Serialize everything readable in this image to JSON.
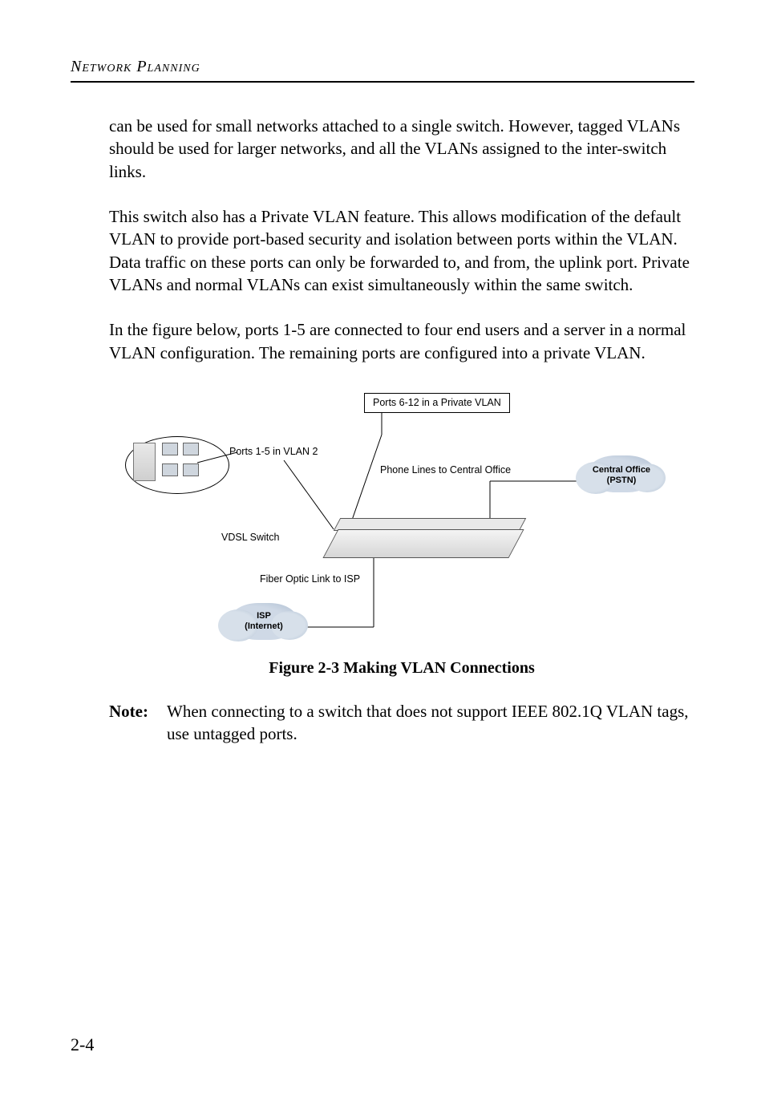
{
  "header": {
    "running_head": "Network Planning"
  },
  "paragraphs": {
    "p1": "can be used for small networks attached to a single switch. However, tagged VLANs should be used for larger networks, and all the VLANs assigned to the inter-switch links.",
    "p2": "This switch also has a Private VLAN feature. This allows modification of the default VLAN to provide port-based security and isolation between ports within the VLAN. Data traffic on these ports can only be forwarded to, and from, the uplink port. Private VLANs and normal VLANs can exist simultaneously within the same switch.",
    "p3": "In the figure below, ports 1-5 are connected to four end users and a server in a normal VLAN configuration. The remaining ports are configured into a private VLAN."
  },
  "figure": {
    "caption": "Figure 2-3  Making VLAN Connections",
    "labels": {
      "private_vlan": "Ports 6-12 in a Private VLAN",
      "ports_1_5": "Ports 1-5 in VLAN 2",
      "phone_lines": "Phone Lines to Central Office",
      "central_office_l1": "Central Office",
      "central_office_l2": "(PSTN)",
      "vdsl_switch": "VDSL Switch",
      "fiber_link": "Fiber Optic Link to ISP",
      "isp_l1": "ISP",
      "isp_l2": "(Internet)"
    }
  },
  "note": {
    "label": "Note:",
    "text": "When connecting to a switch that does not support IEEE 802.1Q VLAN tags, use untagged ports."
  },
  "page_number": "2-4"
}
